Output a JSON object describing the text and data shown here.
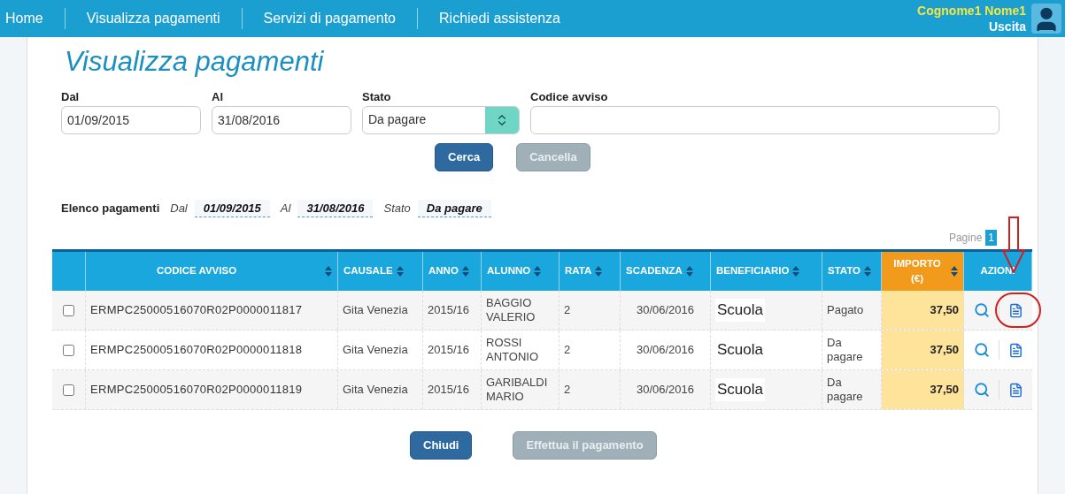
{
  "nav": {
    "items": [
      {
        "label": "Home"
      },
      {
        "label": "Visualizza pagamenti"
      },
      {
        "label": "Servizi di pagamento"
      },
      {
        "label": "Richiedi assistenza"
      }
    ],
    "user_name": "Cognome1 Nome1",
    "logout": "Uscita"
  },
  "page_title": "Visualizza pagamenti",
  "filters": [
    {
      "label": "Dal",
      "kind": "text",
      "value": "01/09/2015"
    },
    {
      "label": "Al",
      "kind": "text",
      "value": "31/08/2016"
    },
    {
      "label": "Stato",
      "kind": "select",
      "value": "Da pagare"
    },
    {
      "label": "Codice avviso",
      "kind": "text"
    }
  ],
  "filter_buttons": [
    {
      "label": "Cerca",
      "disabled": false
    },
    {
      "label": "Cancella",
      "disabled": true
    }
  ],
  "summary": {
    "title": "Elenco pagamenti",
    "parts": [
      {
        "label": "Dal",
        "value": "01/09/2015"
      },
      {
        "label": "Al",
        "value": "31/08/2016"
      },
      {
        "label": "Stato",
        "value": "Da pagare"
      }
    ]
  },
  "pager": {
    "label": "Pagine",
    "pages": [
      {
        "label": "1",
        "selected": true
      }
    ]
  },
  "table": {
    "columns": [
      "CODICE AVVISO",
      "CAUSALE",
      "ANNO",
      "ALUNNO",
      "RATA",
      "SCADENZA",
      "BENEFICIARIO",
      "STATO",
      "IMPORTO (€)",
      "AZIONI"
    ],
    "rows": [
      {
        "checked": false,
        "cells": [
          "ERMPC25000516070R02P0000011817",
          "Gita Venezia",
          "2015/16",
          "BAGGIO VALERIO",
          "2",
          "30/06/2016",
          "Scuola",
          "Pagato",
          "37,50"
        ],
        "highlighted": true
      },
      {
        "checked": false,
        "cells": [
          "ERMPC25000516070R02P0000011818",
          "Gita Venezia",
          "2015/16",
          "ROSSI ANTONIO",
          "2",
          "30/06/2016",
          "Scuola",
          "Da pagare",
          "37,50"
        ],
        "highlighted": false
      },
      {
        "checked": false,
        "cells": [
          "ERMPC25000516070R02P0000011819",
          "Gita Venezia",
          "2015/16",
          "GARIBALDI MARIO",
          "2",
          "30/06/2016",
          "Scuola",
          "Da pagare",
          "37,50"
        ],
        "highlighted": false
      }
    ]
  },
  "bottom_buttons": [
    {
      "label": "Chiudi",
      "disabled": false
    },
    {
      "label": "Effettua il pagamento",
      "disabled": true
    }
  ]
}
